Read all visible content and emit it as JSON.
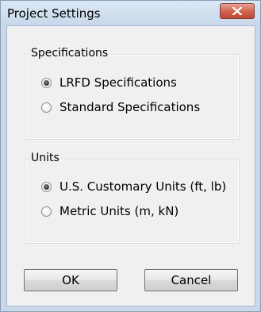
{
  "window": {
    "title": "Project Settings"
  },
  "specifications": {
    "legend": "Specifications",
    "options": [
      {
        "label": "LRFD Specifications",
        "selected": true
      },
      {
        "label": "Standard Specifications",
        "selected": false
      }
    ]
  },
  "units": {
    "legend": "Units",
    "options": [
      {
        "label": "U.S. Customary Units (ft, lb)",
        "selected": true
      },
      {
        "label": "Metric Units (m, kN)",
        "selected": false
      }
    ]
  },
  "buttons": {
    "ok_label": "OK",
    "cancel_label": "Cancel"
  },
  "icons": {
    "close": "close-icon"
  },
  "colors": {
    "title_bar": "#c9d9ea",
    "close_button": "#c9513d",
    "dialog_background": "#f0f0f0"
  }
}
